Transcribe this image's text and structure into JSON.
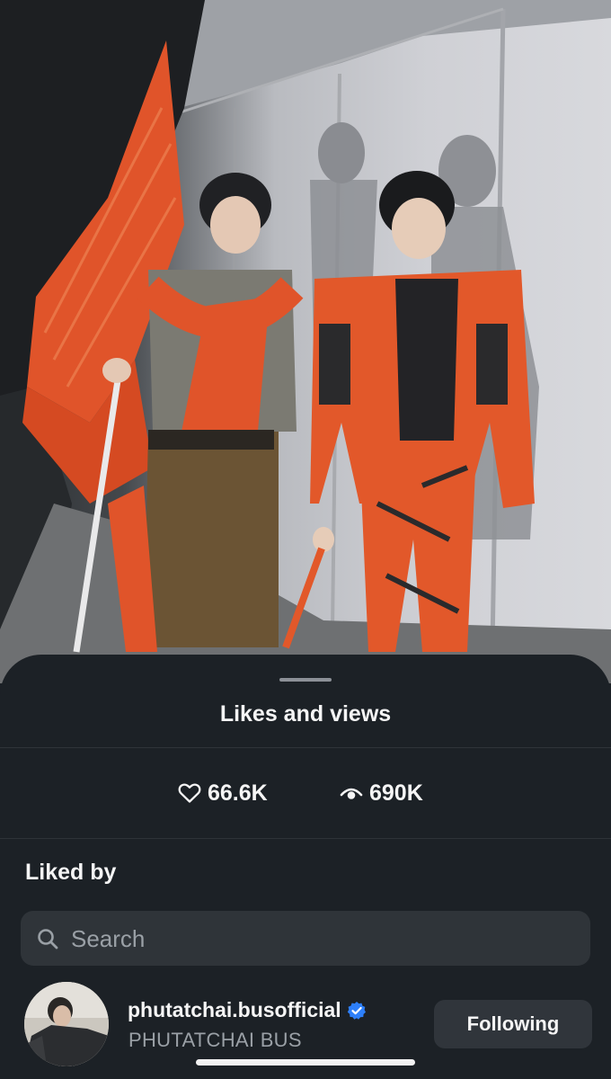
{
  "sheet": {
    "title": "Likes and views"
  },
  "stats": {
    "likes": {
      "icon": "heart-outline-icon",
      "value": "66.6K"
    },
    "views": {
      "icon": "eye-icon",
      "value": "690K"
    }
  },
  "liked_by": {
    "heading": "Liked by",
    "search": {
      "placeholder": "Search",
      "value": "",
      "icon": "search-icon"
    },
    "users": [
      {
        "username": "phutatchai.busofficial",
        "full_name": "PHUTATCHAI BUS",
        "verified": true,
        "button_label": "Following"
      }
    ]
  },
  "colors": {
    "sheet_bg": "#1c2126",
    "search_bg": "#2f3439",
    "button_bg": "#30353b",
    "verified_blue": "#2d7ff9",
    "text_primary": "#f5f5f5",
    "text_secondary": "#9aa0a6",
    "costume_orange": "#e2582a"
  }
}
